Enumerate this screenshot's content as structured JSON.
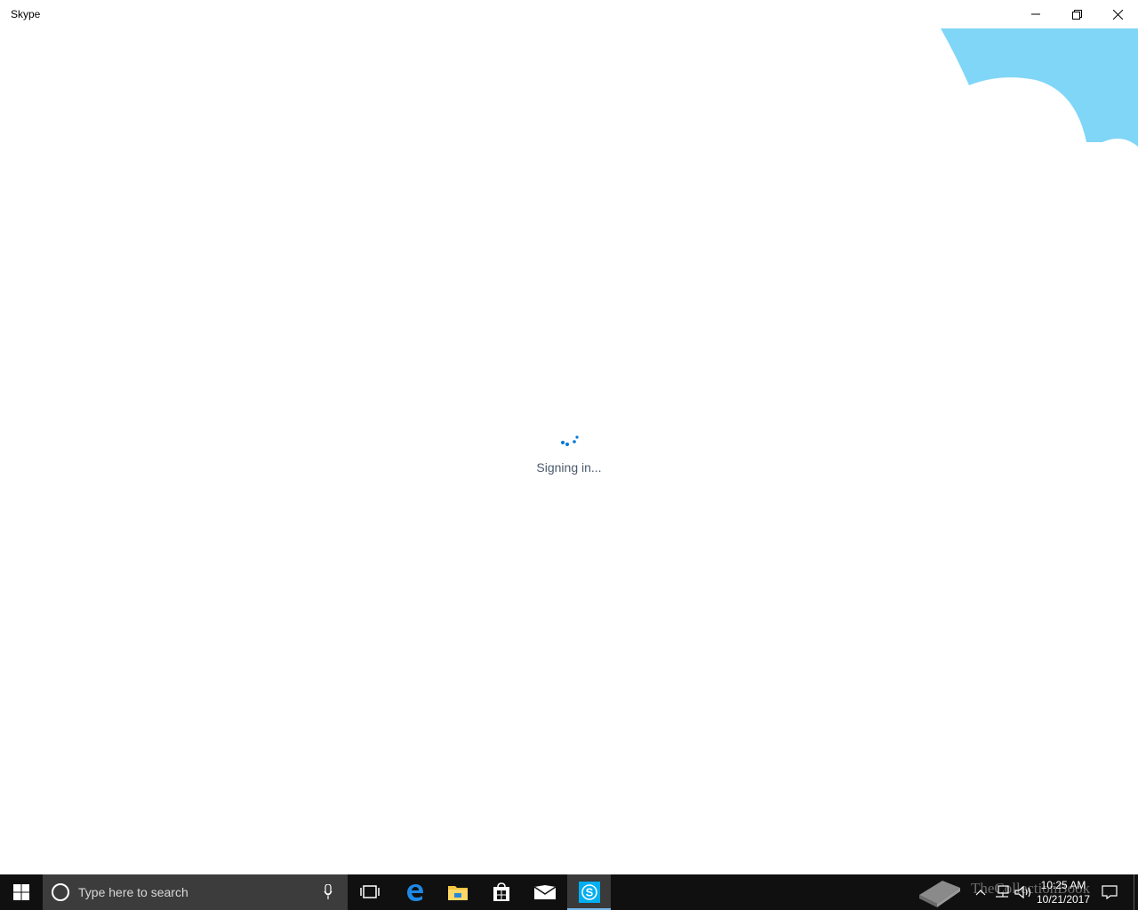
{
  "window": {
    "title": "Skype",
    "buttons": [
      "minimize-icon",
      "restore-icon",
      "close-icon"
    ]
  },
  "main": {
    "status_text": "Signing in...",
    "accent_color": "#0078d7",
    "cloud_color": "#80d6f7"
  },
  "taskbar": {
    "search_placeholder": "Type here to search",
    "apps": [
      "task-view-icon",
      "edge-icon",
      "file-explorer-icon",
      "store-icon",
      "mail-icon",
      "skype-icon"
    ],
    "active_app": "skype-icon",
    "watermark": "TheCollectionBook",
    "clock_time": "10:25 AM",
    "clock_date": "10/21/2017"
  }
}
